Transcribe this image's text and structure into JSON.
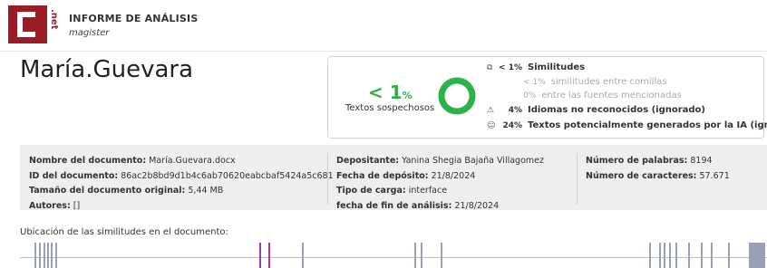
{
  "header": {
    "logo_text": "C",
    "logo_vertical_text": ".net",
    "title": "INFORME DE ANÁLISIS",
    "subtitle": "magister",
    "brand_color": "#9b1c24"
  },
  "document_title": "María.Guevara",
  "summary": {
    "percent_value": "< 1",
    "percent_unit": "%",
    "percent_label": "Textos sospechosos",
    "ring_color": "#2cb24a",
    "rows": [
      {
        "icon": "copy-icon",
        "glyph": "⧉",
        "value": "< 1%",
        "label": "Similitudes"
      },
      {
        "icon": "",
        "glyph": "",
        "value": "< 1%",
        "label": "similitudes entre comillas"
      },
      {
        "icon": "",
        "glyph": "",
        "value": "0%",
        "label": "entre las fuentes mencionadas"
      },
      {
        "icon": "warning-icon",
        "glyph": "⚠",
        "value": "4%",
        "label": "Idiomas no reconocidos (ignorado)"
      },
      {
        "icon": "robot-icon",
        "glyph": "☺",
        "value": "24%",
        "label": "Textos potencialmente generados por la IA (ignorado)"
      }
    ]
  },
  "metadata": {
    "col1": [
      {
        "label": "Nombre del documento:",
        "value": "María.Guevara.docx"
      },
      {
        "label": "ID del documento:",
        "value": "86ac2b8bd9d1b4c6ab70620eabcbaf5424a5c681"
      },
      {
        "label": "Tamaño del documento original:",
        "value": "5,44 MB"
      },
      {
        "label": "Autores:",
        "value": "[]"
      }
    ],
    "col2": [
      {
        "label": "Depositante:",
        "value": "Yanina Shegia Bajaña Villagomez"
      },
      {
        "label": "Fecha de depósito:",
        "value": "21/8/2024"
      },
      {
        "label": "Tipo de carga:",
        "value": "interface"
      },
      {
        "label": "fecha de fin de análisis:",
        "value": "21/8/2024"
      }
    ],
    "col3": [
      {
        "label": "Número de palabras:",
        "value": "8194"
      },
      {
        "label": "Número de caracteres:",
        "value": "57.671"
      }
    ]
  },
  "location": {
    "label": "Ubicación de las similitudes en el documento:",
    "marks": [
      {
        "pos": 0.02,
        "w": 2,
        "color": "#9aa0b4"
      },
      {
        "pos": 0.026,
        "w": 2,
        "color": "#9aa0b4"
      },
      {
        "pos": 0.031,
        "w": 2,
        "color": "#9aa0b4"
      },
      {
        "pos": 0.036,
        "w": 2,
        "color": "#9aa0b4"
      },
      {
        "pos": 0.041,
        "w": 2,
        "color": "#9aa0b4"
      },
      {
        "pos": 0.047,
        "w": 2,
        "color": "#9aa0b4"
      },
      {
        "pos": 0.32,
        "w": 2,
        "color": "#a03a9e"
      },
      {
        "pos": 0.332,
        "w": 2,
        "color": "#a03a9e"
      },
      {
        "pos": 0.378,
        "w": 2,
        "color": "#9aa0b4"
      },
      {
        "pos": 0.528,
        "w": 2,
        "color": "#9aa0b4"
      },
      {
        "pos": 0.536,
        "w": 2,
        "color": "#9aa0b4"
      },
      {
        "pos": 0.563,
        "w": 2,
        "color": "#9aa0b4"
      },
      {
        "pos": 0.842,
        "w": 2,
        "color": "#9aa0b4"
      },
      {
        "pos": 0.855,
        "w": 2,
        "color": "#9aa0b4"
      },
      {
        "pos": 0.862,
        "w": 2,
        "color": "#9aa0b4"
      },
      {
        "pos": 0.869,
        "w": 2,
        "color": "#9aa0b4"
      },
      {
        "pos": 0.878,
        "w": 2,
        "color": "#9aa0b4"
      },
      {
        "pos": 0.895,
        "w": 2,
        "color": "#9aa0b4"
      },
      {
        "pos": 0.912,
        "w": 2,
        "color": "#9aa0b4"
      },
      {
        "pos": 0.925,
        "w": 2,
        "color": "#9aa0b4"
      },
      {
        "pos": 0.948,
        "w": 2,
        "color": "#9aa0b4"
      },
      {
        "pos": 0.976,
        "w": 18,
        "color": "#9aa0b4"
      }
    ]
  }
}
